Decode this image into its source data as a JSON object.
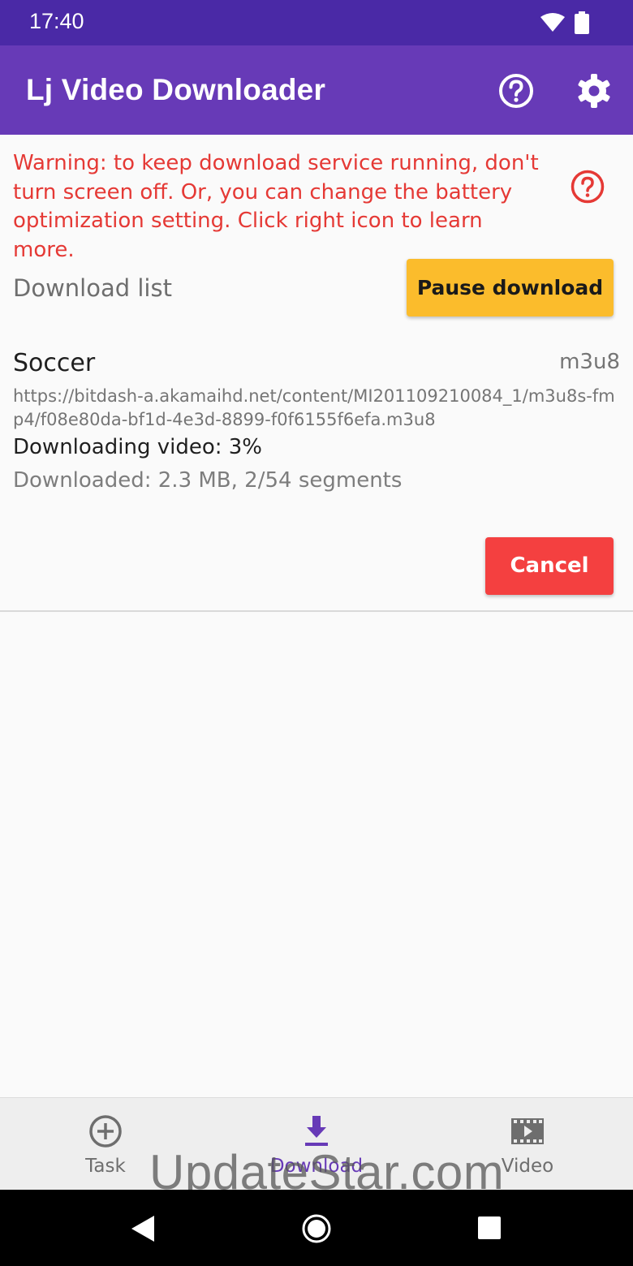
{
  "status_bar": {
    "time": "17:40"
  },
  "app_bar": {
    "title": "Lj Video Downloader",
    "help_icon": "help-circle-icon",
    "settings_icon": "gear-icon"
  },
  "warning": {
    "text": "Warning: to keep download service running, don't turn screen off. Or, you can change the battery optimization setting. Click right icon to learn more.",
    "color": "#e53935"
  },
  "download": {
    "list_label": "Download list",
    "pause_label": "Pause download",
    "items": [
      {
        "title": "Soccer",
        "type": "m3u8",
        "url": "https://bitdash-a.akamaihd.net/content/MI201109210084_1/m3u8s-fmp4/f08e80da-bf1d-4e3d-8899-f0f6155f6efa.m3u8",
        "status": "Downloading video: 3%",
        "progress": "Downloaded: 2.3 MB, 2/54 segments",
        "cancel_label": "Cancel"
      }
    ]
  },
  "bottom_nav": {
    "items": [
      {
        "label": "Task",
        "icon": "add-circle-icon",
        "active": false
      },
      {
        "label": "Download",
        "icon": "download-icon",
        "active": true
      },
      {
        "label": "Video",
        "icon": "film-icon",
        "active": false
      }
    ]
  },
  "watermark": "UpdateStar.com",
  "colors": {
    "status_bar": "#4a29a6",
    "app_bar": "#673ab7",
    "pause_button": "#fbbc2c",
    "cancel_button": "#f44040",
    "active_nav": "#673ab7"
  }
}
